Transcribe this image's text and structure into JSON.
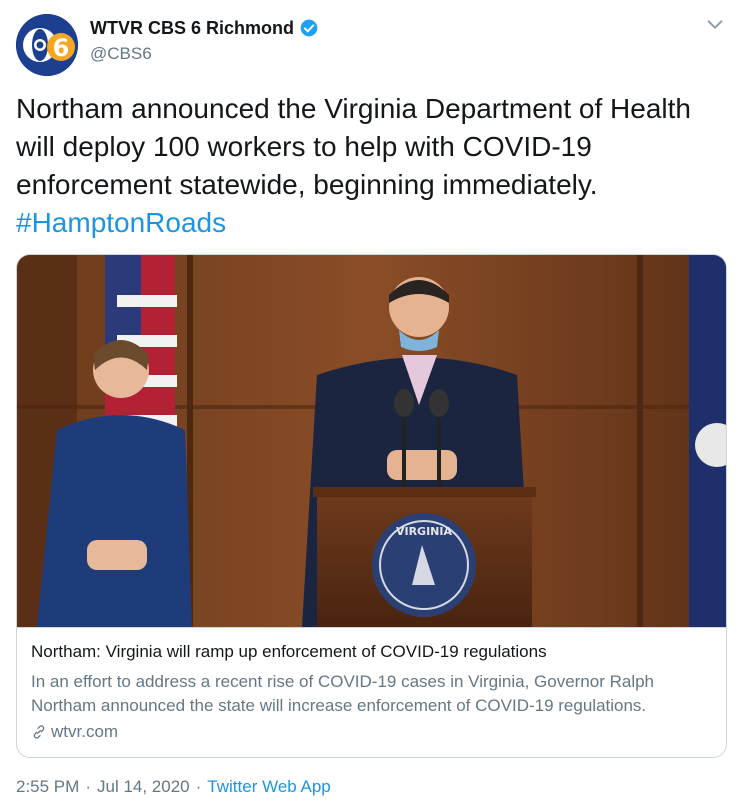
{
  "account": {
    "display_name": "WTVR CBS 6 Richmond",
    "handle": "@CBS6",
    "avatar": "cbs6-logo",
    "verified": true
  },
  "tweet": {
    "text": "Northam announced the Virginia Department of Health will deploy 100 workers to help with COVID-19 enforcement statewide, beginning immediately.",
    "hashtag": "#HamptonRoads"
  },
  "card": {
    "image": "press-conference-photo",
    "title": "Northam: Virginia will ramp up enforcement of COVID-19 regulations",
    "description": "In an effort to address a recent rise of COVID-19 cases in Virginia, Governor Ralph Northam announced the state will increase enforcement of COVID-19 regulations.",
    "domain": "wtvr.com",
    "seal_text": "VIRGINIA"
  },
  "meta": {
    "time": "2:55 PM",
    "separator1": "·",
    "date": "Jul 14, 2020",
    "separator2": "·",
    "source": "Twitter Web App"
  },
  "icons": {
    "verified": "verified-badge-icon",
    "caret": "chevron-down-icon",
    "link": "link-icon"
  },
  "colors": {
    "link_blue": "#1b95e0",
    "secondary_text": "#657786",
    "border": "#ccd6dd"
  }
}
